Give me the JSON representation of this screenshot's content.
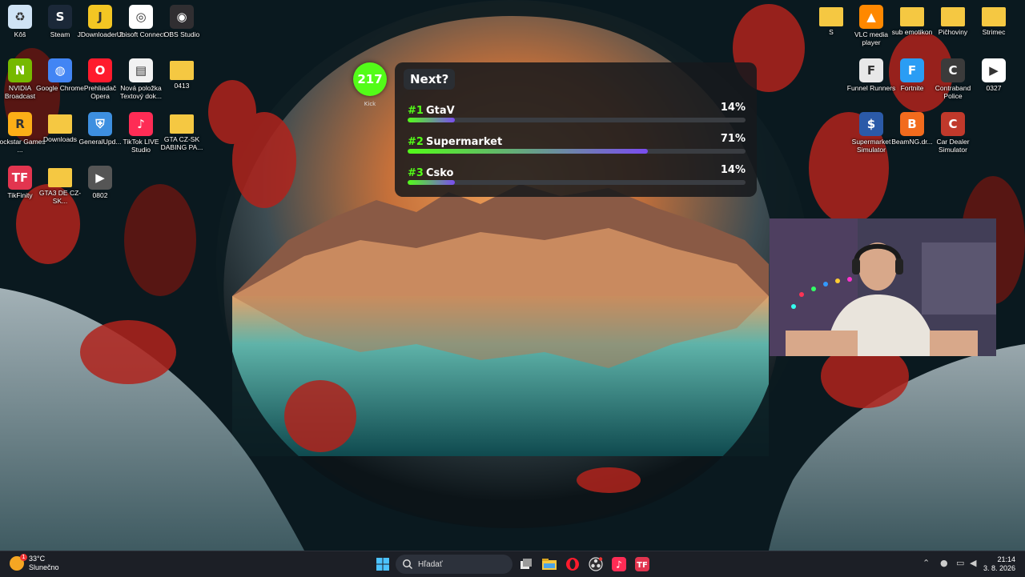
{
  "desktop": {
    "left_icons": [
      {
        "label": "Kôš",
        "icon": "recycle-bin-icon",
        "color": "#cfe3f5"
      },
      {
        "label": "Steam",
        "icon": "steam-icon",
        "color": "#1b2838"
      },
      {
        "label": "JDownloader 2",
        "icon": "jdownloader-icon",
        "color": "#f3c623"
      },
      {
        "label": "Ubisoft Connect",
        "icon": "ubisoft-icon",
        "color": "#ffffff"
      },
      {
        "label": "OBS Studio",
        "icon": "obs-icon",
        "color": "#302e31"
      },
      {
        "label": "NVIDIA Broadcast",
        "icon": "nvidia-icon",
        "color": "#76b900"
      },
      {
        "label": "Google Chrome",
        "icon": "chrome-icon",
        "color": "#4285f4"
      },
      {
        "label": "Prehliadač Opera",
        "icon": "opera-icon",
        "color": "#ff1b2d"
      },
      {
        "label": "Nová položka Textový dok...",
        "icon": "text-document-icon",
        "color": "#f2f2f2"
      },
      {
        "label": "0413",
        "icon": "folder-icon",
        "color": "#f5c842"
      },
      {
        "label": "Rockstar Games ...",
        "icon": "rockstar-icon",
        "color": "#fcaf17"
      },
      {
        "label": "Downloads",
        "icon": "folder-icon",
        "color": "#f5c842"
      },
      {
        "label": "GeneralUpd...",
        "icon": "shield-icon",
        "color": "#3d8fe0"
      },
      {
        "label": "TikTok LIVE Studio",
        "icon": "tiktok-icon",
        "color": "#fe2c55"
      },
      {
        "label": "GTA CZ-SK DABING PA...",
        "icon": "folder-icon",
        "color": "#f5c842"
      },
      {
        "label": "TikFinity",
        "icon": "tikfinity-icon",
        "color": "#e2354f"
      },
      {
        "label": "GTA3 DE CZ-SK...",
        "icon": "folder-icon",
        "color": "#f5c842"
      },
      {
        "label": "0802",
        "icon": "video-file-icon",
        "color": "#555555"
      }
    ],
    "right_icons": [
      {
        "label": "S",
        "icon": "folder-icon",
        "color": "#f5c842"
      },
      {
        "label": "VLC media player",
        "icon": "vlc-icon",
        "color": "#ff8800"
      },
      {
        "label": "sub emotikon",
        "icon": "folder-icon",
        "color": "#f5c842"
      },
      {
        "label": "Pičhoviny",
        "icon": "folder-icon",
        "color": "#f5c842"
      },
      {
        "label": "Strimec",
        "icon": "folder-icon",
        "color": "#f5c842"
      },
      {
        "label": "Funnel Runners",
        "icon": "funnel-runners-icon",
        "color": "#e8e8e8"
      },
      {
        "label": "Fortnite",
        "icon": "fortnite-icon",
        "color": "#2a9df4"
      },
      {
        "label": "Contraband Police",
        "icon": "contraband-police-icon",
        "color": "#3b3b3b"
      },
      {
        "label": "0327",
        "icon": "video-file-icon",
        "color": "#ffffff"
      },
      {
        "label": "Supermarket Simulator",
        "icon": "supermarket-simulator-icon",
        "color": "#2b5aa8"
      },
      {
        "label": "BeamNG.dr...",
        "icon": "beamng-icon",
        "color": "#f26b1d"
      },
      {
        "label": "Car Dealer Simulator",
        "icon": "car-dealer-icon",
        "color": "#c0392b"
      }
    ]
  },
  "poll": {
    "viewer_count": "217",
    "viewer_label": "Kick",
    "question": "Next?",
    "options": [
      {
        "rank": "#1",
        "name": "GtaV",
        "percent_label": "14%",
        "percent": 14
      },
      {
        "rank": "#2",
        "name": "Supermarket",
        "percent_label": "71%",
        "percent": 71
      },
      {
        "rank": "#3",
        "name": "Csko",
        "percent_label": "14%",
        "percent": 14
      }
    ]
  },
  "taskbar": {
    "weather_temp": "33°C",
    "weather_desc": "Slunečno",
    "weather_badge": "1",
    "search_placeholder": "Hľadať",
    "time": "21:14",
    "date": "3. 8. 2026",
    "pinned": [
      "windows-start-icon",
      "task-view-icon",
      "file-explorer-icon",
      "opera-icon",
      "obs-icon",
      "tiktok-icon",
      "tikfinity-icon"
    ]
  }
}
